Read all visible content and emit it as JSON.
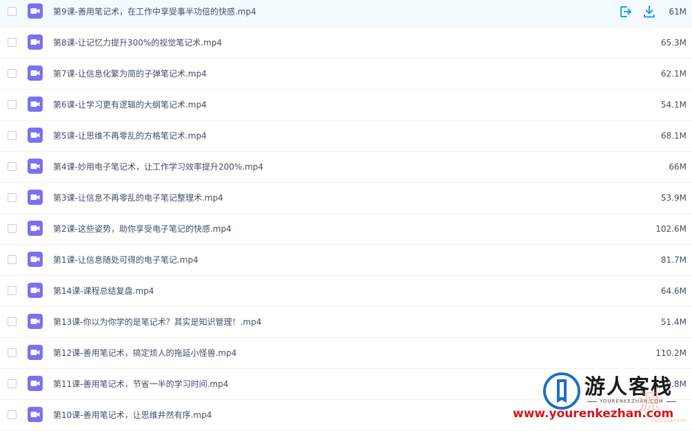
{
  "files": [
    {
      "name": "第9课-善用笔记术，在工作中享受事半功倍的快感.mp4",
      "size": "61M",
      "hover": true
    },
    {
      "name": "第8课-让记忆力提升300%的视觉笔记术.mp4",
      "size": "65.3M"
    },
    {
      "name": "第7课-让信息化繁为简的子弹笔记术.mp4",
      "size": "62.1M"
    },
    {
      "name": "第6课-让学习更有逻辑的大纲笔记术.mp4",
      "size": "54.1M"
    },
    {
      "name": "第5课-让思维不再零乱的方格笔记术.mp4",
      "size": "68.1M"
    },
    {
      "name": "第4课-妙用电子笔记术，让工作学习效率提升200%.mp4",
      "size": "66M"
    },
    {
      "name": "第3课-让信息不再零乱的电子笔记整理术.mp4",
      "size": "53.9M"
    },
    {
      "name": "第2课-这些姿势，助你享受电子笔记的快感.mp4",
      "size": "102.6M"
    },
    {
      "name": "第1课-让信息随处可得的电子笔记.mp4",
      "size": "81.7M"
    },
    {
      "name": "第14课-课程总结复盘.mp4",
      "size": "64.6M"
    },
    {
      "name": "第13课-你以为你学的是笔记术？其实是知识管理！.mp4",
      "size": "51.4M"
    },
    {
      "name": "第12课-善用笔记术，搞定烦人的拖延小怪兽.mp4",
      "size": "110.2M"
    },
    {
      "name": "第11课-善用笔记术，节省一半的学习时间.mp4",
      "size": "0.8M"
    },
    {
      "name": "第10课-善用笔记术，让思维井然有序.mp4",
      "size": ""
    }
  ],
  "row_action_icons": [
    "share-icon",
    "download-icon"
  ],
  "file_type_icon": "video-file-icon",
  "colors": {
    "accent": "#1a9cf0",
    "video_icon": "#7b70f0",
    "text": "#424e67",
    "watermark_red": "#d6141c"
  },
  "watermark": {
    "title": "游人客栈",
    "subtitle": "YOURENKEZHAN.COM",
    "url": "www.yourenkezhan.com",
    "ghost": "源",
    "ghost_small": "Qu21yuan.com"
  }
}
